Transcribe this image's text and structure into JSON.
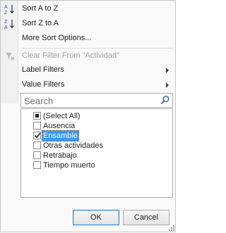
{
  "menu": {
    "sort_asc": {
      "label": "Sort A to Z",
      "icon": "sort-a-to-z-icon"
    },
    "sort_desc": {
      "label": "Sort Z to A",
      "icon": "sort-z-to-a-icon"
    },
    "more_sort": {
      "label": "More Sort Options..."
    },
    "clear_filter": {
      "label": "Clear Filter From \"Actividad\"",
      "icon": "clear-filter-icon",
      "enabled": false
    },
    "label_filters": {
      "label": "Label Filters"
    },
    "value_filters": {
      "label": "Value Filters"
    }
  },
  "search": {
    "placeholder": "Search",
    "icon": "search-icon"
  },
  "filter_list": {
    "select_all": {
      "label": "(Select All)",
      "state": "partial"
    },
    "items": [
      {
        "label": "Ausencia",
        "checked": false
      },
      {
        "label": "Ensamble",
        "checked": true,
        "selected": true
      },
      {
        "label": "Otras actividades",
        "checked": false
      },
      {
        "label": "Retrabajo",
        "checked": false
      },
      {
        "label": "Tiempo muerto",
        "checked": false
      }
    ]
  },
  "buttons": {
    "ok": "OK",
    "cancel": "Cancel"
  },
  "colors": {
    "selection": "#3399ff",
    "disabled_text": "#a0a0a0"
  }
}
